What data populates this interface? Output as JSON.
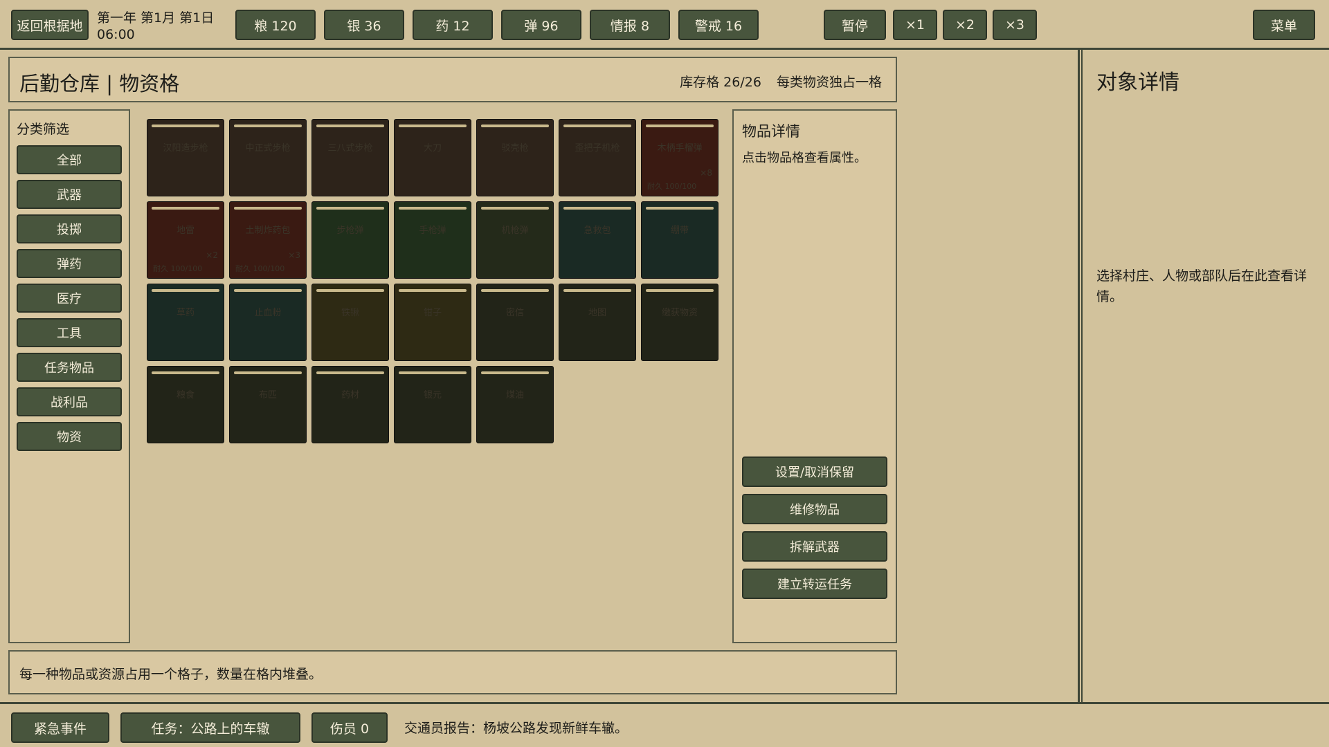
{
  "topbar": {
    "back_label": "返回根据地",
    "date_line1": "第一年 第1月 第1日",
    "date_line2": "06:00",
    "resources": [
      "粮 120",
      "银 36",
      "药 12",
      "弹 96",
      "情报 8",
      "警戒 16"
    ],
    "pause_label": "暂停",
    "speeds": [
      "×1",
      "×2",
      "×3"
    ],
    "menu_label": "菜单"
  },
  "header": {
    "title": "后勤仓库 | 物资格",
    "stock": "库存格 26/26",
    "rule": "每类物资独占一格"
  },
  "filters": {
    "title": "分类筛选",
    "items": [
      "全部",
      "武器",
      "投掷",
      "弹药",
      "医疗",
      "工具",
      "任务物品",
      "战利品",
      "物资"
    ]
  },
  "grid": {
    "cells": [
      {
        "name": "汉阳造步枪",
        "count": "",
        "dur": "",
        "color": "brown"
      },
      {
        "name": "中正式步枪",
        "count": "",
        "dur": "",
        "color": "brown"
      },
      {
        "name": "三八式步枪",
        "count": "",
        "dur": "",
        "color": "brown"
      },
      {
        "name": "大刀",
        "count": "",
        "dur": "",
        "color": "brown"
      },
      {
        "name": "驳壳枪",
        "count": "",
        "dur": "",
        "color": "brown"
      },
      {
        "name": "歪把子机枪",
        "count": "",
        "dur": "",
        "color": "brown"
      },
      {
        "name": "木柄手榴弹",
        "count": "×8",
        "dur": "耐久 100/100",
        "color": "red"
      },
      {
        "name": "地雷",
        "count": "×2",
        "dur": "耐久 100/100",
        "color": "red"
      },
      {
        "name": "土制炸药包",
        "count": "×3",
        "dur": "耐久 100/100",
        "color": "red"
      },
      {
        "name": "步枪弹",
        "count": "",
        "dur": "",
        "color": "green"
      },
      {
        "name": "手枪弹",
        "count": "",
        "dur": "",
        "color": "green"
      },
      {
        "name": "机枪弹",
        "count": "",
        "dur": "",
        "color": "olive"
      },
      {
        "name": "急救包",
        "count": "",
        "dur": "",
        "color": "teal"
      },
      {
        "name": "绷带",
        "count": "",
        "dur": "",
        "color": "teal"
      },
      {
        "name": "草药",
        "count": "",
        "dur": "",
        "color": "teal"
      },
      {
        "name": "止血粉",
        "count": "",
        "dur": "",
        "color": "teal"
      },
      {
        "name": "铁锹",
        "count": "",
        "dur": "",
        "color": "amber"
      },
      {
        "name": "钳子",
        "count": "",
        "dur": "",
        "color": "amber"
      },
      {
        "name": "密信",
        "count": "",
        "dur": "",
        "color": "dark"
      },
      {
        "name": "地图",
        "count": "",
        "dur": "",
        "color": "dark"
      },
      {
        "name": "缴获物资",
        "count": "",
        "dur": "",
        "color": "dark"
      },
      {
        "name": "粮食",
        "count": "",
        "dur": "",
        "color": "dark"
      },
      {
        "name": "布匹",
        "count": "",
        "dur": "",
        "color": "dark"
      },
      {
        "name": "药材",
        "count": "",
        "dur": "",
        "color": "dark"
      },
      {
        "name": "银元",
        "count": "",
        "dur": "",
        "color": "dark"
      },
      {
        "name": "煤油",
        "count": "",
        "dur": "",
        "color": "dark"
      }
    ]
  },
  "item_detail": {
    "title": "物品详情",
    "hint": "点击物品格查看属性。",
    "actions": [
      "设置/取消保留",
      "维修物品",
      "拆解武器",
      "建立转运任务"
    ]
  },
  "footer_note": "每一种物品或资源占用一个格子，数量在格内堆叠。",
  "right_panel": {
    "title": "对象详情",
    "hint": "选择村庄、人物或部队后在此查看详情。"
  },
  "bottombar": {
    "event_label": "紧急事件",
    "task_label": "任务：公路上的车辙",
    "wounded_label": "伤员 0",
    "report": "交通员报告：杨坡公路发现新鲜车辙。"
  }
}
